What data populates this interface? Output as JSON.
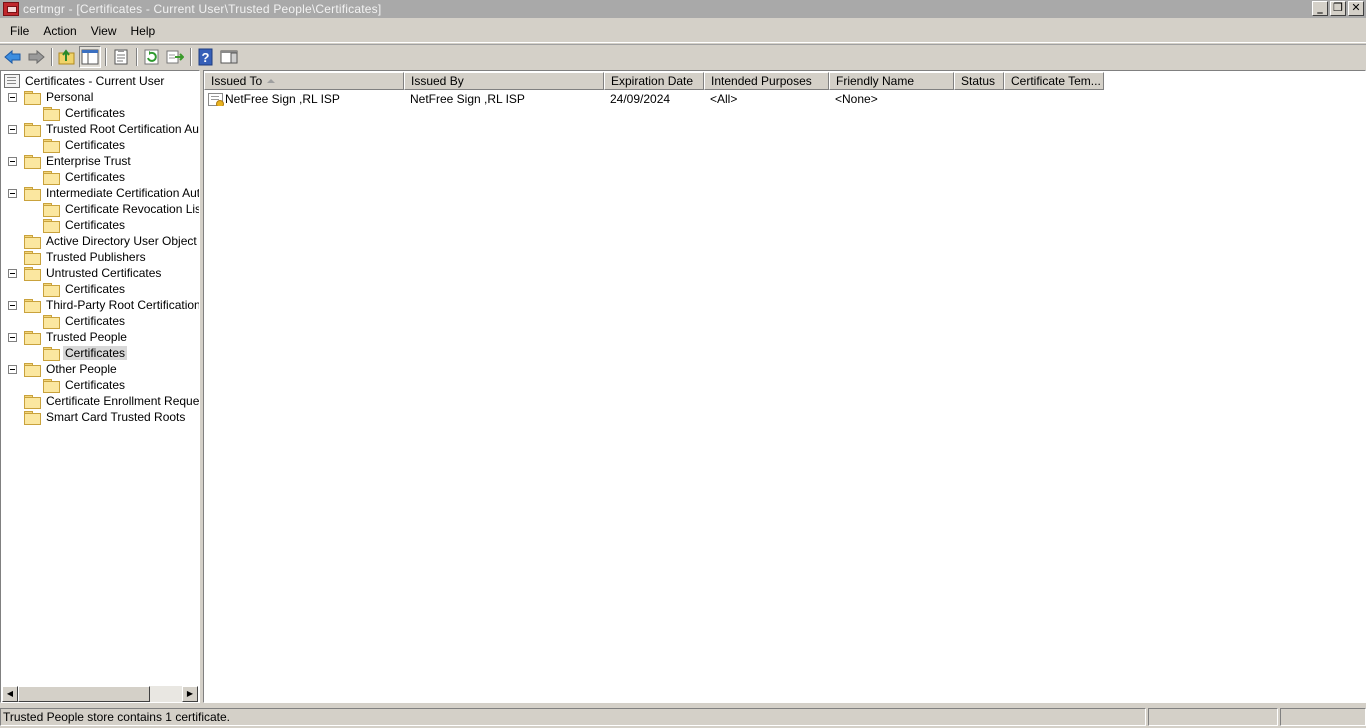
{
  "window": {
    "title": "certmgr - [Certificates - Current User\\Trusted People\\Certificates]",
    "minimize": "_",
    "restore": "❐",
    "close": "✕"
  },
  "menu": [
    {
      "label": "File"
    },
    {
      "label": "Action"
    },
    {
      "label": "View"
    },
    {
      "label": "Help"
    }
  ],
  "toolbar": {
    "icons": [
      "back-arrow-icon",
      "forward-arrow-icon",
      "up-folder-icon",
      "show-hide-tree-icon",
      "properties-icon",
      "refresh-icon",
      "export-list-icon",
      "help-icon",
      "show-hide-action-pane-icon"
    ]
  },
  "tree": {
    "root": "Certificates - Current User",
    "items": [
      {
        "label": "Personal"
      },
      {
        "label": "Certificates"
      },
      {
        "label": "Trusted Root Certification Autho"
      },
      {
        "label": "Certificates"
      },
      {
        "label": "Enterprise Trust"
      },
      {
        "label": "Certificates"
      },
      {
        "label": "Intermediate Certification Autho"
      },
      {
        "label": "Certificate Revocation List"
      },
      {
        "label": "Certificates"
      },
      {
        "label": "Active Directory User Object"
      },
      {
        "label": "Trusted Publishers"
      },
      {
        "label": "Untrusted Certificates"
      },
      {
        "label": "Certificates"
      },
      {
        "label": "Third-Party Root Certification Au"
      },
      {
        "label": "Certificates"
      },
      {
        "label": "Trusted People"
      },
      {
        "label": "Certificates"
      },
      {
        "label": "Other People"
      },
      {
        "label": "Certificates"
      },
      {
        "label": "Certificate Enrollment Requests"
      },
      {
        "label": "Smart Card Trusted Roots"
      }
    ],
    "selected": "Trusted People / Certificates"
  },
  "list": {
    "columns": [
      "Issued To",
      "Issued By",
      "Expiration Date",
      "Intended Purposes",
      "Friendly Name",
      "Status",
      "Certificate Tem..."
    ],
    "sort_column": "Issued To",
    "rows": [
      {
        "issued_to": "NetFree Sign ,RL ISP",
        "issued_by": "NetFree Sign ,RL ISP",
        "expiration": "24/09/2024",
        "purposes": "<All>",
        "friendly_name": "<None>",
        "status": "",
        "template": ""
      }
    ]
  },
  "status": {
    "text": "Trusted People store contains 1 certificate."
  },
  "colors": {
    "titlebar_inactive": "#a9a9a9",
    "chrome": "#d4d0c8",
    "selection": "#d8d8d8"
  }
}
